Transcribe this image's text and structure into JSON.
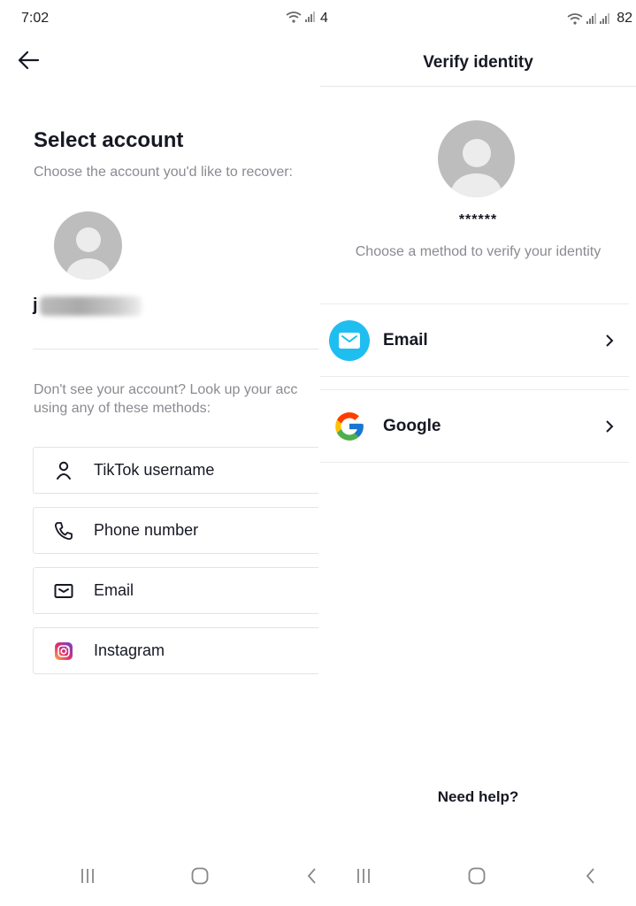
{
  "left_screen": {
    "status_bar": {
      "time": "7:02"
    },
    "title": "Select account",
    "subtitle": "Choose the account you'd like to recover:",
    "account": {
      "username_visible": "j",
      "username_redacted": true
    },
    "lookup_text_line1": "Don't see your account? Look up your acc",
    "lookup_text_line2": "using any of these methods:",
    "methods": [
      {
        "label": "TikTok username",
        "icon": "person-icon"
      },
      {
        "label": "Phone number",
        "icon": "phone-icon"
      },
      {
        "label": "Email",
        "icon": "envelope-icon"
      },
      {
        "label": "Instagram",
        "icon": "instagram-icon"
      }
    ]
  },
  "right_screen": {
    "status_bar": {
      "time_fragment": "4",
      "battery": "82"
    },
    "header": {
      "title": "Verify identity"
    },
    "masked_username": "******",
    "instruction": "Choose a method to verify your identity",
    "verify_methods": [
      {
        "label": "Email",
        "icon": "email-circle-icon",
        "color": "#1fbef0"
      },
      {
        "label": "Google",
        "icon": "google-icon"
      }
    ],
    "help_link": "Need help?"
  },
  "colors": {
    "primary_text": "#161823",
    "secondary_text": "#8a8b91",
    "email_blue": "#1fbef0",
    "divider": "#e6e6e8"
  }
}
